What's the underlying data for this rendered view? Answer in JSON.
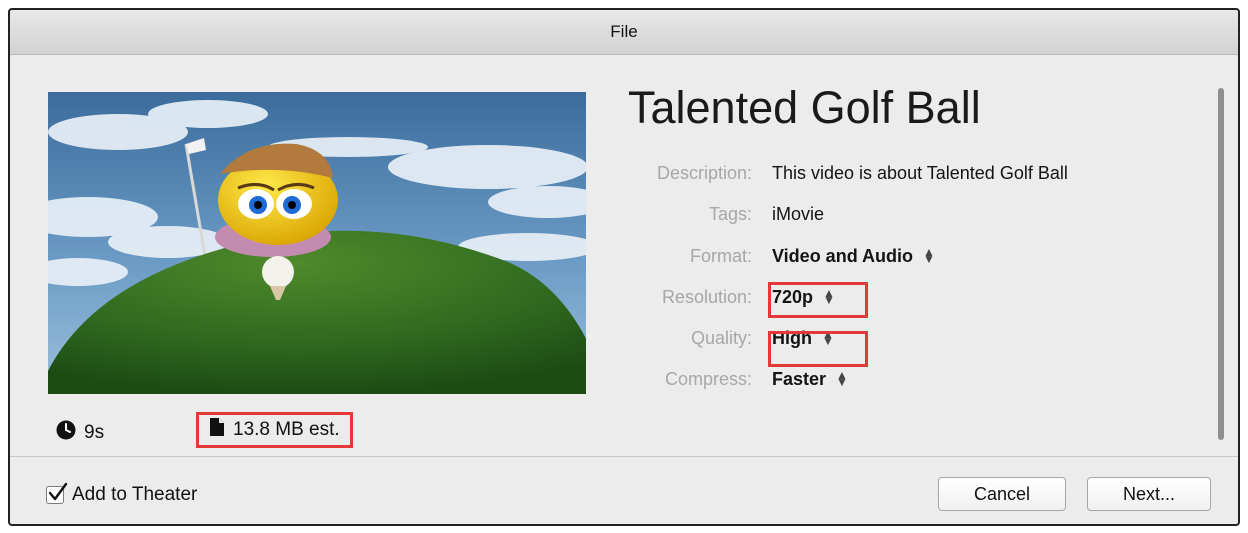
{
  "window": {
    "title": "File"
  },
  "preview": {
    "duration": "9s",
    "file_size": "13.8 MB est."
  },
  "details": {
    "title": "Talented Golf Ball",
    "fields": [
      {
        "label": "Description:",
        "value": "This video is about Talented Golf Ball"
      },
      {
        "label": "Tags:",
        "value": "iMovie"
      },
      {
        "label": "Format:",
        "value": "Video and Audio"
      },
      {
        "label": "Resolution:",
        "value": "720p"
      },
      {
        "label": "Quality:",
        "value": "High"
      },
      {
        "label": "Compress:",
        "value": "Faster"
      }
    ]
  },
  "footer": {
    "add_to_theater_label": "Add to Theater",
    "add_to_theater_checked": true,
    "cancel_label": "Cancel",
    "next_label": "Next..."
  },
  "colors": {
    "highlight": "#e53838",
    "window_bg": "#ececec"
  },
  "icons": [
    "clock-icon",
    "document-icon",
    "checkbox-checked-icon",
    "stepper-arrows-icon"
  ]
}
